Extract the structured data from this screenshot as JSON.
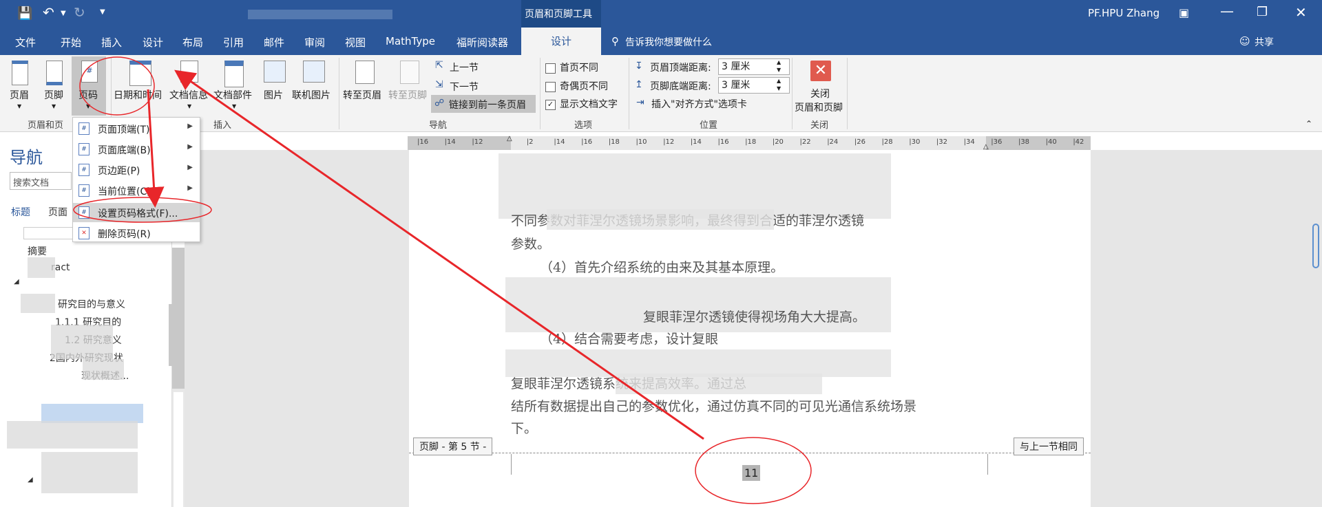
{
  "titlebar": {
    "context_tool": "页眉和页脚工具",
    "user": "PF.HPU Zhang"
  },
  "menu": {
    "tabs": [
      "文件",
      "开始",
      "插入",
      "设计",
      "布局",
      "引用",
      "邮件",
      "审阅",
      "视图",
      "MathType",
      "福昕阅读器"
    ],
    "active_tab": "设计",
    "tell_me": "告诉我你想要做什么",
    "share": "共享"
  },
  "ribbon": {
    "header": "页眉",
    "footer": "页脚",
    "page_number": "页码",
    "datetime": "日期和时间",
    "docinfo": "文档信息",
    "docparts": "文档部件",
    "picture": "图片",
    "online_picture": "联机图片",
    "goto_header": "转至页眉",
    "goto_footer": "转至页脚",
    "prev_section": "上一节",
    "next_section": "下一节",
    "link_previous": "链接到前一条页眉",
    "diff_first": "首页不同",
    "diff_odd_even": "奇偶页不同",
    "show_text": "显示文档文字",
    "header_top_label": "页眉顶端距离:",
    "header_top_value": "3 厘米",
    "footer_bottom_label": "页脚底端距离:",
    "footer_bottom_value": "3 厘米",
    "insert_align_tab": "插入\"对齐方式\"选项卡",
    "close_label_1": "关闭",
    "close_label_2": "页眉和页脚",
    "groups": {
      "header_footer": "页眉和页",
      "insert": "插入",
      "navigation": "导航",
      "options": "选项",
      "position": "位置",
      "close": "关闭"
    }
  },
  "dropdown": {
    "items": [
      {
        "label": "页面顶端(T)",
        "has_submenu": true
      },
      {
        "label": "页面底端(B)",
        "has_submenu": true
      },
      {
        "label": "页边距(P)",
        "has_submenu": true
      },
      {
        "label": "当前位置(C)",
        "has_submenu": true
      },
      {
        "label": "设置页码格式(F)...",
        "has_submenu": false
      },
      {
        "label": "删除页码(R)",
        "has_submenu": false
      }
    ]
  },
  "nav": {
    "title": "导航",
    "search_placeholder": "搜索文档",
    "tab_headings": "标题",
    "tab_pages": "页面",
    "outline": [
      "摘要",
      "ract",
      "研究目的与意义",
      "1.1.1 研究目的",
      "1.2 研究意义",
      "2国内外研究现状",
      "现状概述..."
    ]
  },
  "ruler": {
    "ticks": [
      "16",
      "14",
      "12",
      "",
      "2",
      "14",
      "16",
      "18",
      "10",
      "12",
      "14",
      "16",
      "18",
      "20",
      "22",
      "24",
      "26",
      "28",
      "30",
      "32",
      "34",
      "36",
      "38",
      "40",
      "42"
    ]
  },
  "document": {
    "lines": [
      "不同参数对菲涅尔透镜场景影响，最终得到合适的菲涅尔透镜",
      "参数。",
      "（4）首先介绍系统的由来及其基本原理。",
      "复眼菲涅尔透镜使得视场角大大提高。",
      "（4）结合需要考虑，设计复眼",
      "复眼菲涅尔透镜系统来提高效率。通过总",
      "结所有数据提出自己的参数优化，通过仿真不同的可见光通信系统场景",
      "下。"
    ],
    "footer_tag": "页脚 - 第 5 节 -",
    "same_as_previous": "与上一节相同",
    "page_number": "11"
  },
  "colors": {
    "accent": "#2b579a",
    "annotation": "#e8262a"
  }
}
